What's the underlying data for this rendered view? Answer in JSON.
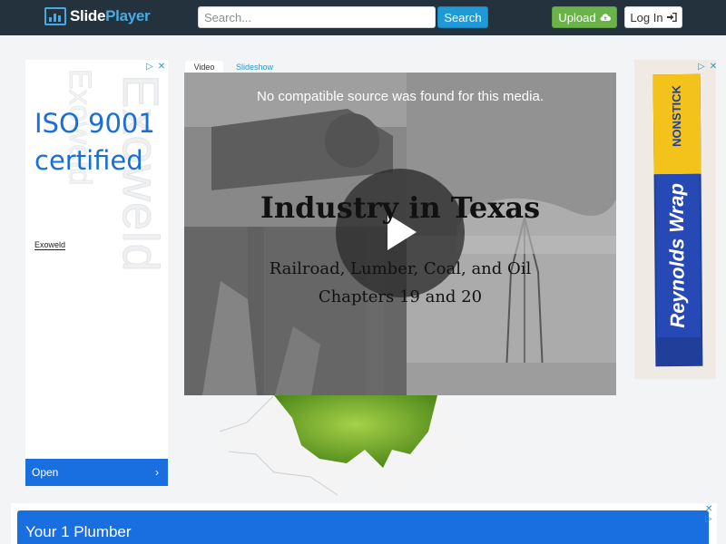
{
  "header": {
    "logo_slide": "Slide",
    "logo_player": "Player",
    "search_placeholder": "Search...",
    "search_button": "Search",
    "upload_button": "Upload",
    "login_button": "Log In"
  },
  "ad_left": {
    "watermark": "Exoweld",
    "headline": "ISO 9001 certified",
    "brand": "Exoweld",
    "cta": "Open"
  },
  "tabs": [
    {
      "label": "Video",
      "active": true
    },
    {
      "label": "Slideshow",
      "active": false
    }
  ],
  "player": {
    "error": "No compatible source was found for this media.",
    "slide_title": "Industry in Texas",
    "slide_sub1": "Railroad, Lumber, Coal, and Oil",
    "slide_sub2": "Chapters 19 and 20"
  },
  "ad_right": {
    "product": "Reynolds Wrap",
    "tag": "NONSTICK"
  },
  "ad_bottom": {
    "text": "Your 1 Plumber"
  },
  "colors": {
    "header_bg": "#24323d",
    "accent_blue": "#1f9ad6",
    "upload_green": "#6ab34a",
    "ad_blue": "#1a6fe0"
  }
}
